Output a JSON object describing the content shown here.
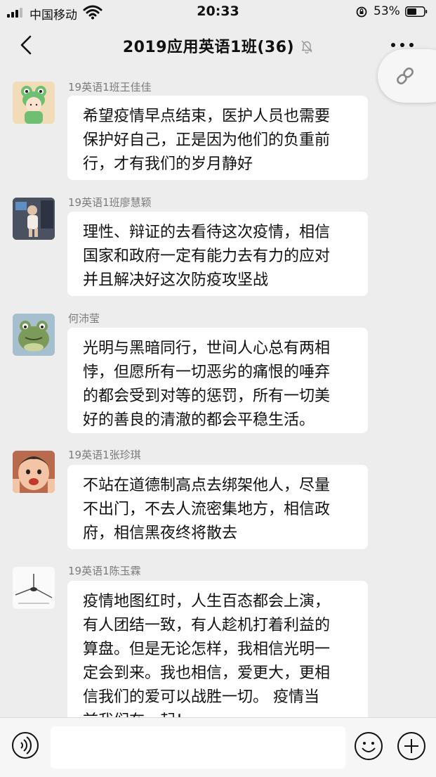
{
  "status": {
    "carrier": "中国移动",
    "time": "20:33",
    "battery": "53%"
  },
  "nav": {
    "title": "2019应用英语1班(36)"
  },
  "messages": [
    {
      "name": "19英语1班王佳佳",
      "lines": [
        "希望疫情早点结束，医护人员也需要",
        "保护好自己，正是因为他们的负重前",
        "行，才有我们的岁月静好"
      ]
    },
    {
      "name": "19英语1班廖慧颖",
      "lines": [
        "理性、辩证的去看待这次疫情，相信",
        "国家和政府一定有能力去有力的应对",
        "并且解决好这次防疫攻坚战"
      ]
    },
    {
      "name": "何沛莹",
      "lines": [
        "光明与黑暗同行，世间人心总有两相",
        "悖，但愿所有一切恶劣的痛恨的唾弃",
        "的都会受到对等的惩罚，所有一切美",
        "好的善良的清澈的都会平稳生活。"
      ]
    },
    {
      "name": "19英语1张珍琪",
      "lines": [
        "不站在道德制高点去绑架他人，尽量",
        "不出门，不去人流密集地方，相信政",
        "府，相信黑夜终将散去"
      ]
    },
    {
      "name": "19英语1陈玉霖",
      "lines": [
        "疫情地图红时，人生百态都会上演，",
        "有人团结一致，有人趁机打着利益的",
        "算盘。但是无论怎样，我相信光明一",
        "定会到来。我也相信，爱更大，更相",
        "信我们的爱可以战胜一切。 疫情当",
        "前我们在一起！"
      ]
    }
  ],
  "icons": {
    "back": "chevron-left-icon",
    "mute": "bell-slash-icon",
    "more": "more-dots-icon",
    "link": "link-icon",
    "voice": "voice-icon",
    "emoji": "emoji-icon",
    "plus": "plus-icon"
  }
}
